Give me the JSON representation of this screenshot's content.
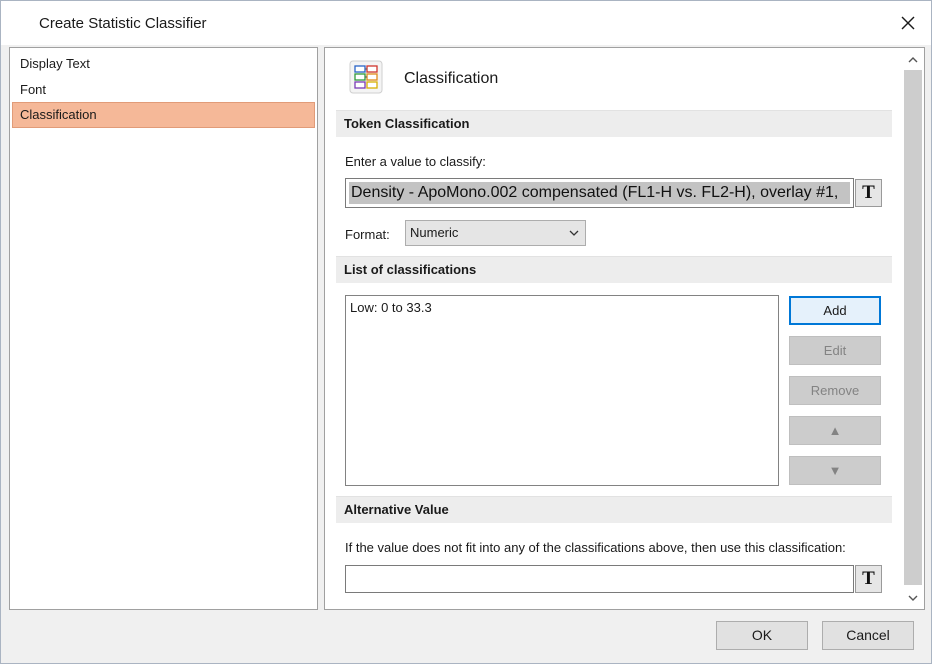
{
  "window": {
    "title": "Create Statistic Classifier"
  },
  "nav": {
    "items": [
      {
        "label": "Display Text",
        "selected": false
      },
      {
        "label": "Font",
        "selected": false
      },
      {
        "label": "Classification",
        "selected": true
      }
    ]
  },
  "content": {
    "header_title": "Classification",
    "header_icon": "classification-icon",
    "token_section": {
      "heading": "Token Classification",
      "prompt": "Enter a value to classify:",
      "token_value": "Density - ApoMono.002 compensated (FL1-H vs. FL2-H), overlay #1,",
      "token_button": "T",
      "format_label": "Format:",
      "format_value": "Numeric"
    },
    "list_section": {
      "heading": "List of classifications",
      "items": [
        "Low: 0 to 33.3"
      ],
      "buttons": {
        "add": "Add",
        "edit": "Edit",
        "remove": "Remove",
        "up": "▲",
        "down": "▼"
      }
    },
    "alt_section": {
      "heading": "Alternative Value",
      "prompt": "If the value does not fit into any of the classifications above, then use this classification:",
      "value": "",
      "token_button": "T"
    }
  },
  "footer": {
    "ok": "OK",
    "cancel": "Cancel"
  },
  "colors": {
    "selection_bg": "#f5b898",
    "primary_border": "#0078d7",
    "section_bg": "#ededed",
    "chip_bg": "#c3c3c3"
  }
}
